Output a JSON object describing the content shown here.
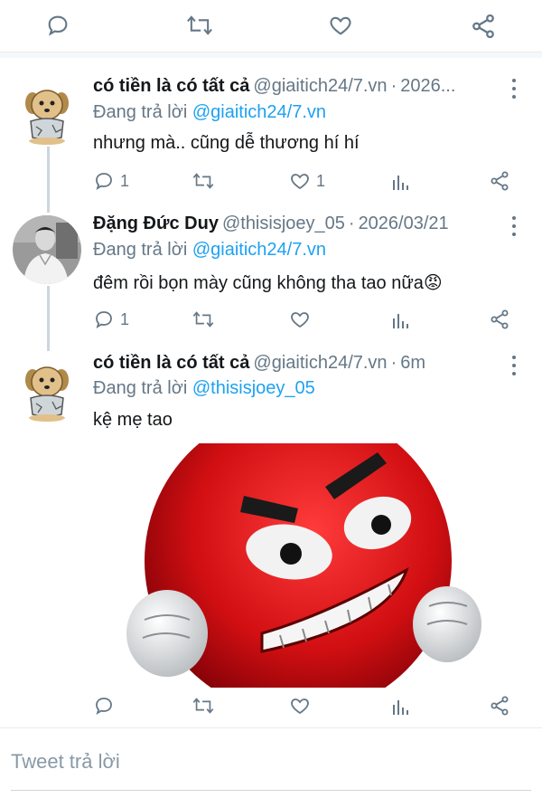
{
  "top_actions": {
    "reply_icon": "reply-icon",
    "retweet_icon": "retweet-icon",
    "like_icon": "heart-icon",
    "share_icon": "share-icon"
  },
  "tweets": [
    {
      "name": "có tiền là có tất cả",
      "handle": "@giaitich24/7.vn",
      "separator": "·",
      "time": "2026...",
      "replying_prefix": "Đang trả lời",
      "replying_to": "@giaitich24/7.vn",
      "text": "nhưng mà.. cũng dễ thương hí hí",
      "reply_count": "1",
      "retweet_count": "",
      "like_count": "1",
      "avatar": "dog-avatar"
    },
    {
      "name": "Đặng Đức Duy",
      "handle": "@thisisjoey_05",
      "separator": "·",
      "time": "2026/03/21",
      "replying_prefix": "Đang trả lời",
      "replying_to": "@giaitich24/7.vn",
      "text": "đêm rồi bọn mày cũng không tha tao nữa😡",
      "reply_count": "1",
      "retweet_count": "",
      "like_count": "",
      "avatar": "person-photo-avatar"
    },
    {
      "name": "có tiền là có tất cả",
      "handle": "@giaitich24/7.vn",
      "separator": "·",
      "time": "6m",
      "replying_prefix": "Đang trả lời",
      "replying_to": "@thisisjoey_05",
      "text": "kệ mẹ tao",
      "reply_count": "",
      "retweet_count": "",
      "like_count": "",
      "avatar": "dog-avatar",
      "media": "angry-red-emoji-image"
    }
  ],
  "reply_box": {
    "placeholder": "Tweet trả lời"
  },
  "colors": {
    "accent": "#1da1f2",
    "muted": "#657786",
    "text": "#14171a",
    "divider": "#e6ecf0"
  }
}
